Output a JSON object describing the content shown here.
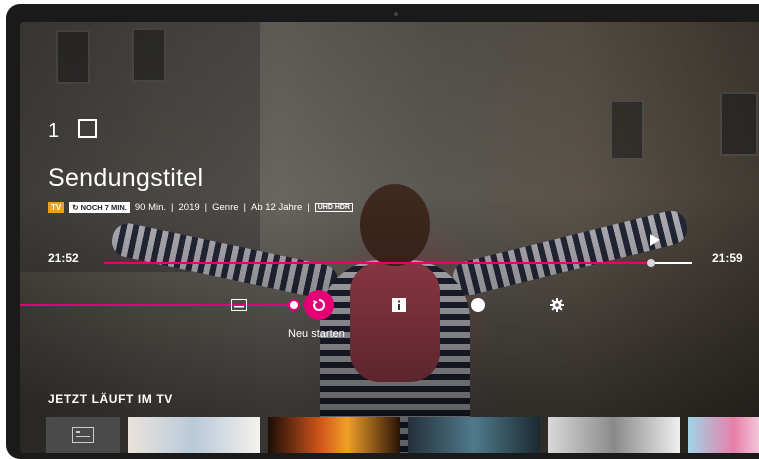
{
  "channel": {
    "number": "1"
  },
  "program": {
    "title": "Sendungstitel",
    "badge_tv": "TV",
    "remaining": "NOCH 7 MIN.",
    "duration": "90 Min.",
    "year": "2019",
    "genre": "Genre",
    "age": "Ab 12 Jahre",
    "format_badge": "UHD HDR",
    "separator": "|"
  },
  "playback": {
    "start_time": "21:52",
    "end_time": "21:59",
    "progress_fraction": 0.93
  },
  "controls": {
    "focused_label": "Neu starten",
    "items": [
      "subtitles-icon",
      "restart-icon",
      "info-icon",
      "record-icon",
      "settings-icon"
    ]
  },
  "section": {
    "title": "JETZT LÄUFT IM TV"
  },
  "colors": {
    "accent": "#e20074",
    "badge_tv": "#f0a020"
  }
}
